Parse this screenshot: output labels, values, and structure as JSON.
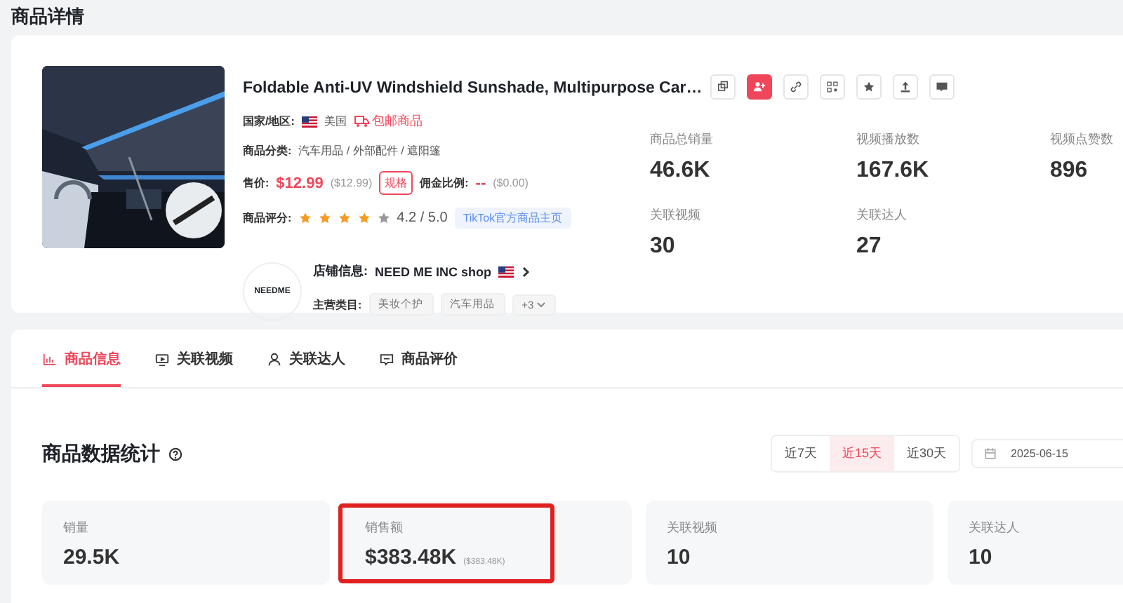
{
  "page_title": "商品详情",
  "product": {
    "title": "Foldable Anti-UV Windshield Sunshade, Multipurpose Car…",
    "country_label": "国家/地区:",
    "country": "美国",
    "badge": "包邮商品",
    "category_label": "商品分类:",
    "category": "汽车用品 / 外部配件 / 遮阳篷",
    "price_label": "售价:",
    "price": "$12.99",
    "price_usd": "($12.99)",
    "spec_button": "规格",
    "commission_label": "佣金比例:",
    "commission": "--",
    "commission_usd": "($0.00)",
    "rating_label": "商品评分:",
    "stars": 4,
    "rating": "4.2 / 5.0",
    "tiktok_link": "TikTok官方商品主页"
  },
  "actions": [
    {
      "active": false
    },
    {
      "active": true
    },
    {
      "active": false
    },
    {
      "active": false
    },
    {
      "active": false
    },
    {
      "active": false
    },
    {
      "active": false
    }
  ],
  "shop": {
    "logo_text": "NEEDME",
    "label": "店铺信息:",
    "name": "NEED ME INC shop",
    "main_label": "主营类目:",
    "tags": [
      "美妆个护",
      "汽车用品"
    ],
    "more": "+3"
  },
  "stats": [
    {
      "label": "商品总销量",
      "value": "46.6K"
    },
    {
      "label": "视频播放数",
      "value": "167.6K"
    },
    {
      "label": "视频点赞数",
      "value": "896"
    },
    {
      "label": "关联视频",
      "value": "30"
    },
    {
      "label": "关联达人",
      "value": "27"
    }
  ],
  "tabs": [
    {
      "label": "商品信息",
      "selected": true
    },
    {
      "label": "关联视频",
      "selected": false
    },
    {
      "label": "关联达人",
      "selected": false
    },
    {
      "label": "商品评价",
      "selected": false
    }
  ],
  "section_title": "商品数据统计",
  "ranges": [
    {
      "label": "近7天",
      "selected": false
    },
    {
      "label": "近15天",
      "selected": true
    },
    {
      "label": "近30天",
      "selected": false
    }
  ],
  "date": "2025-06-15",
  "metrics": [
    {
      "label": "销量",
      "value": "29.5K",
      "highlighted": false
    },
    {
      "label": "销售额",
      "value": "$383.48K",
      "sub": "($383.48K)",
      "highlighted": true
    },
    {
      "label": "关联视频",
      "value": "10",
      "highlighted": false
    },
    {
      "label": "关联达人",
      "value": "10",
      "highlighted": false
    }
  ]
}
